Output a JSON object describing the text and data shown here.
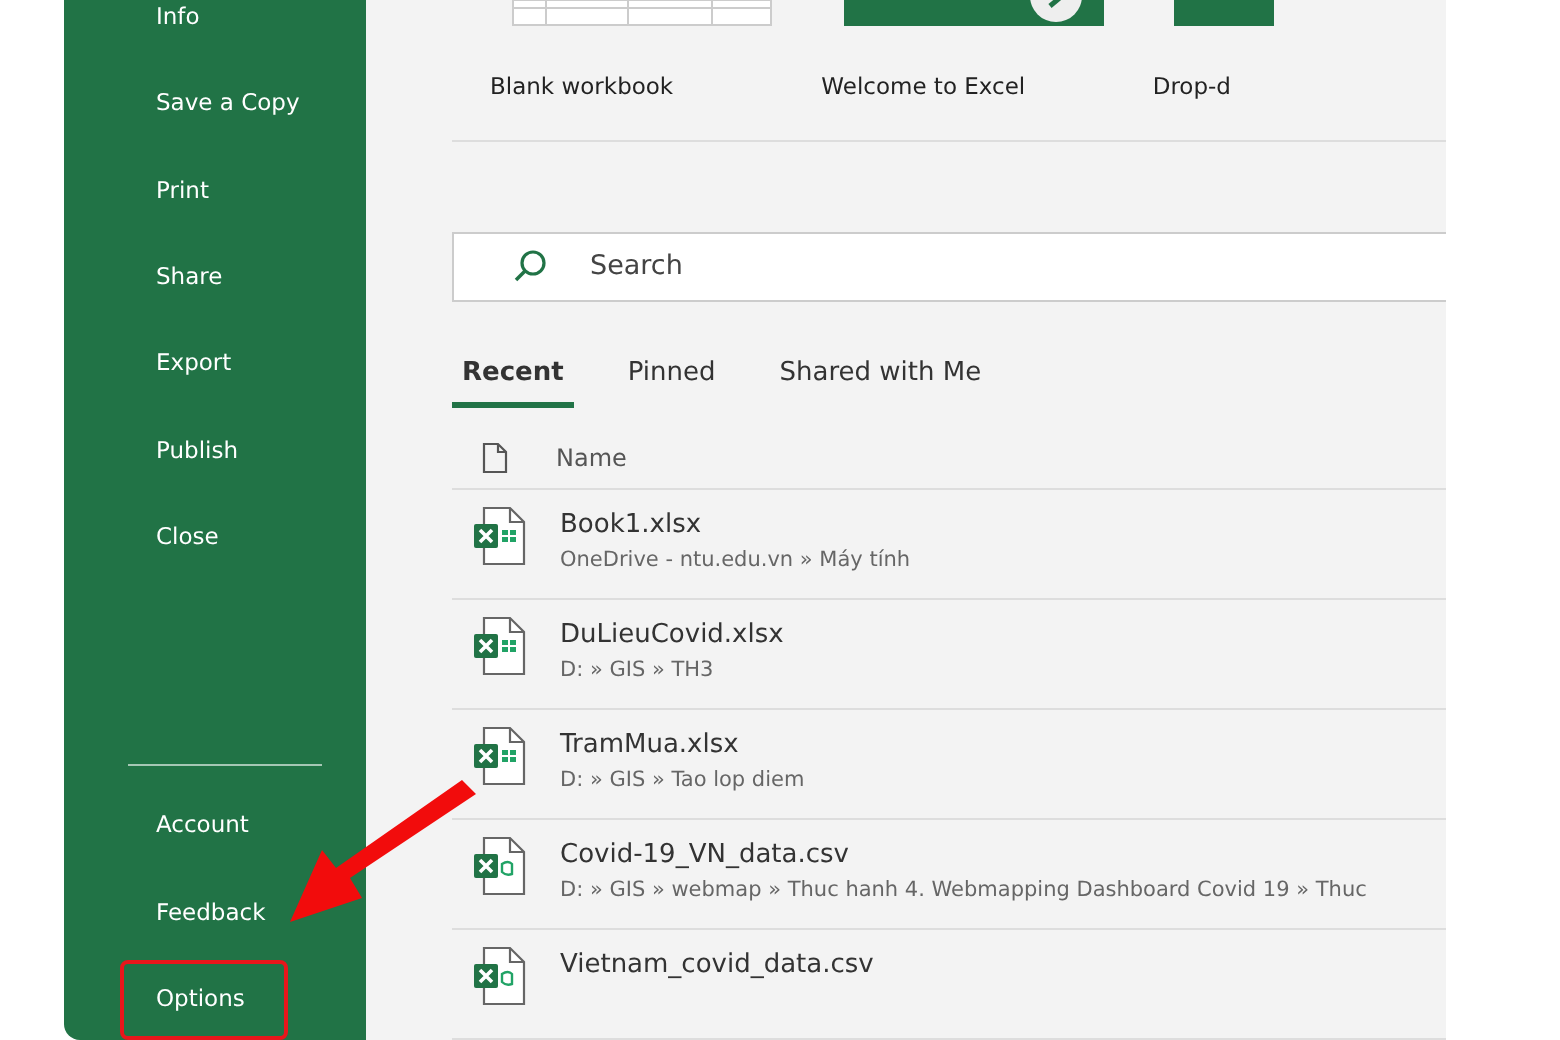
{
  "sidebar": {
    "top_items": [
      {
        "label": "Info",
        "highlighted": false
      },
      {
        "label": "Save a Copy",
        "highlighted": false
      },
      {
        "label": "Print",
        "highlighted": false
      },
      {
        "label": "Share",
        "highlighted": false
      },
      {
        "label": "Export",
        "highlighted": false
      },
      {
        "label": "Publish",
        "highlighted": false
      },
      {
        "label": "Close",
        "highlighted": false
      }
    ],
    "bottom_items": [
      {
        "label": "Account",
        "highlighted": false
      },
      {
        "label": "Feedback",
        "highlighted": false
      },
      {
        "label": "Options",
        "highlighted": true
      }
    ]
  },
  "templates": [
    {
      "label": "Blank workbook",
      "kind": "blank"
    },
    {
      "label": "Welcome to Excel",
      "kind": "tour"
    },
    {
      "label": "Drop-d",
      "kind": "plain"
    }
  ],
  "search": {
    "placeholder": "Search"
  },
  "tabs": [
    {
      "label": "Recent",
      "selected": true
    },
    {
      "label": "Pinned",
      "selected": false
    },
    {
      "label": "Shared with Me",
      "selected": false
    }
  ],
  "file_list": {
    "column": "Name",
    "files": [
      {
        "name": "Book1.xlsx",
        "path": "OneDrive - ntu.edu.vn » Máy tính",
        "kind": "xlsx"
      },
      {
        "name": "DuLieuCovid.xlsx",
        "path": "D: » GIS » TH3",
        "kind": "xlsx"
      },
      {
        "name": "TramMua.xlsx",
        "path": "D: » GIS » Tao lop diem",
        "kind": "xlsx"
      },
      {
        "name": "Covid-19_VN_data.csv",
        "path": "D: » GIS » webmap » Thuc hanh 4. Webmapping  Dashboard Covid 19 » Thuc",
        "kind": "csv"
      },
      {
        "name": "Vietnam_covid_data.csv",
        "kind": "csv"
      }
    ]
  }
}
